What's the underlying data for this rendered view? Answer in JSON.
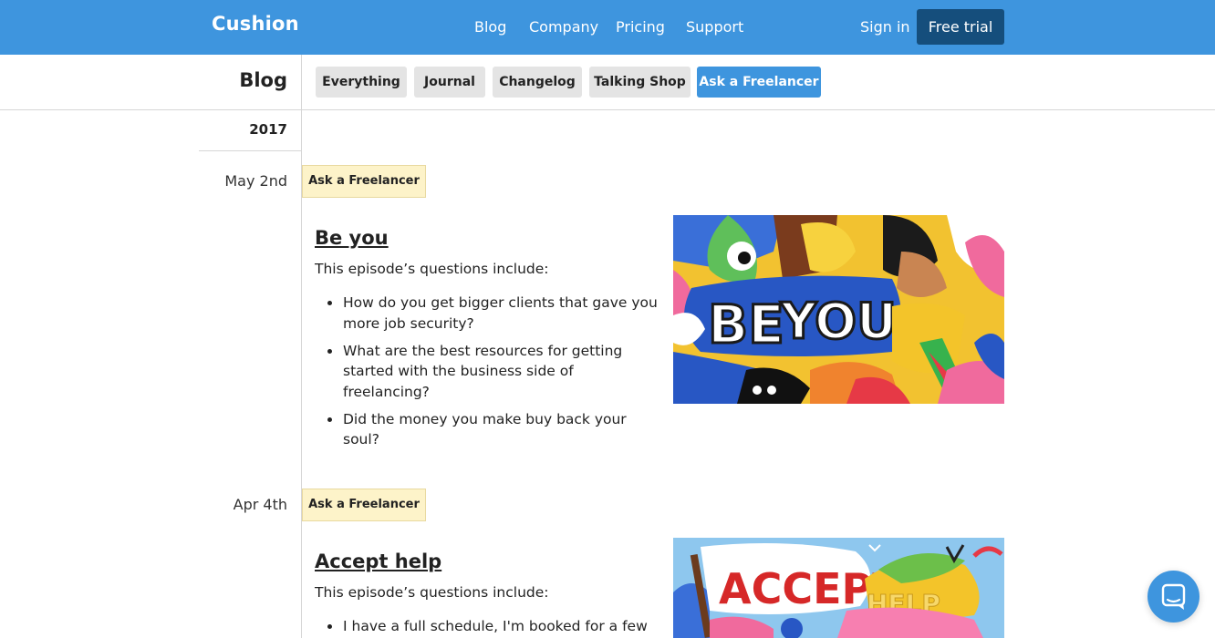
{
  "header": {
    "logo": "Cushion",
    "nav": [
      "Blog",
      "Company",
      "Pricing",
      "Support"
    ],
    "sign_in": "Sign in",
    "free_trial": "Free trial"
  },
  "subheader": {
    "title": "Blog",
    "filters": [
      "Everything",
      "Journal",
      "Changelog",
      "Talking Shop",
      "Ask a Freelancer"
    ],
    "active_filter": "Ask a Freelancer"
  },
  "year": "2017",
  "posts": [
    {
      "date": "May 2nd",
      "tag": "Ask a Freelancer",
      "title": "Be you",
      "intro": "This episode’s questions include:",
      "questions": [
        "How do you get bigger clients that gave you more job security?",
        "What are the best resources for getting started with the business side of freelancing?",
        "Did the money you make buy back your soul?"
      ],
      "image_text": "BE YOU"
    },
    {
      "date": "Apr 4th",
      "tag": "Ask a Freelancer",
      "title": "Accept help",
      "intro": "This episode’s questions include:",
      "questions": [
        "I have a full schedule, I'm booked for a few"
      ],
      "image_text": [
        "ACCEPT",
        "HELP"
      ]
    }
  ],
  "colors": {
    "brand_blue": "#3e95de",
    "dark_button": "#154e7c",
    "tag_background": "#fdf3c9"
  },
  "icons": {
    "chat": "chat-bubble-icon"
  }
}
